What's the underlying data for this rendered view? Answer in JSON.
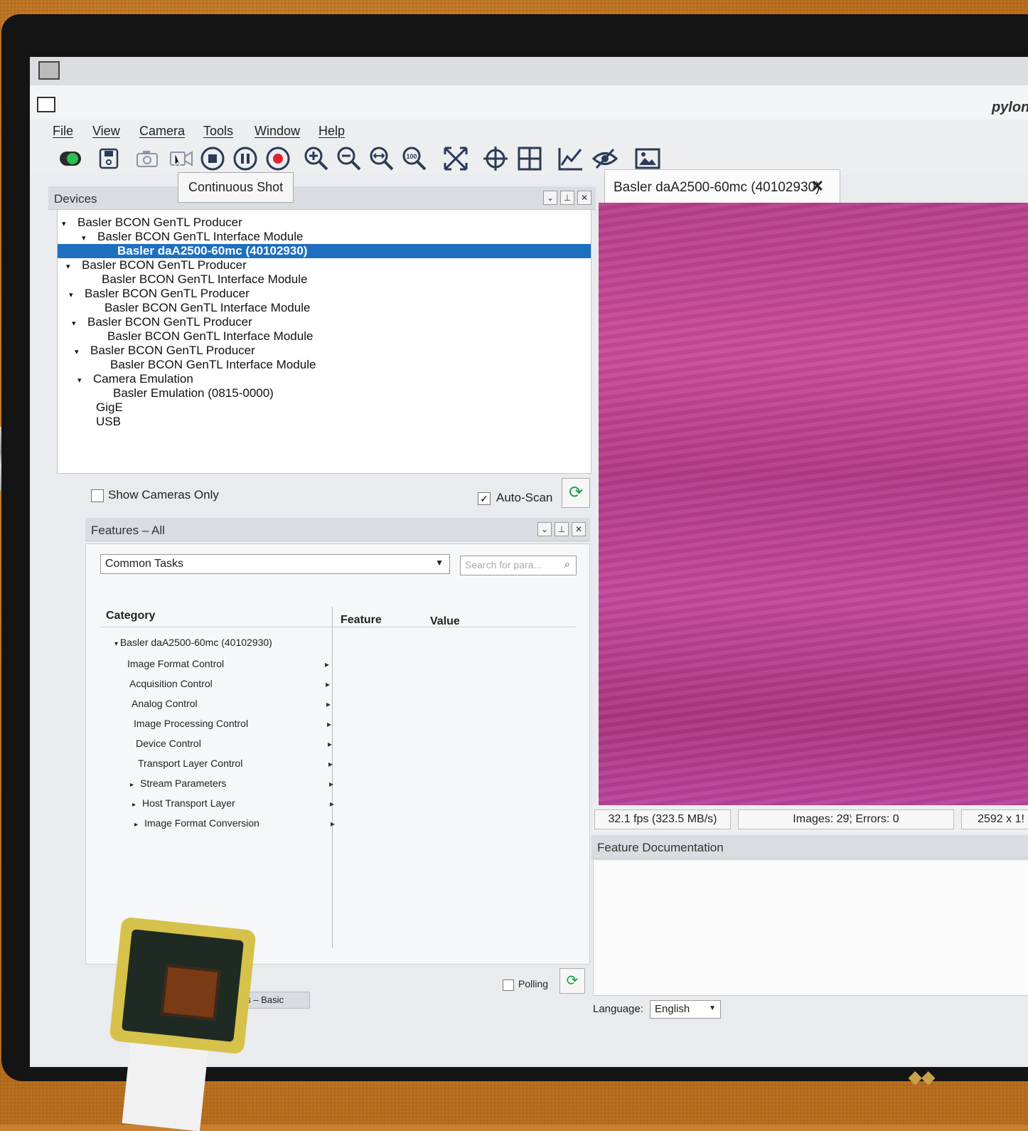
{
  "app": {
    "title": "pylon Vi"
  },
  "menu": [
    "File",
    "View",
    "Camera",
    "Tools",
    "Window",
    "Help"
  ],
  "toolbar": {
    "icons": [
      "device-toggle-icon",
      "save-icon",
      "single-shot-icon",
      "continuous-shot-icon",
      "stop-icon",
      "pause-icon",
      "record-icon",
      "zoom-in-icon",
      "zoom-out-icon",
      "zoom-fit-icon",
      "zoom-100-icon",
      "fullscreen-icon",
      "crosshair-icon",
      "grid-icon",
      "histogram-icon",
      "hide-icon",
      "image-icon"
    ],
    "tooltip": "Continuous Shot",
    "zoom_100_label": "100"
  },
  "devices": {
    "title": "Devices",
    "tree": [
      {
        "label": "Basler BCON GenTL Producer",
        "caret": "▾"
      },
      {
        "label": "Basler BCON GenTL Interface Module",
        "caret": "▾"
      },
      {
        "label": "Basler daA2500-60mc (40102930)",
        "caret": "",
        "selected": true
      },
      {
        "label": "Basler BCON GenTL Producer",
        "caret": "▾"
      },
      {
        "label": "Basler BCON GenTL Interface Module",
        "caret": ""
      },
      {
        "label": "Basler BCON GenTL Producer",
        "caret": "▾"
      },
      {
        "label": "Basler BCON GenTL Interface Module",
        "caret": ""
      },
      {
        "label": "Basler BCON GenTL Producer",
        "caret": "▾"
      },
      {
        "label": "Basler BCON GenTL Interface Module",
        "caret": ""
      },
      {
        "label": "Basler BCON GenTL Producer",
        "caret": "▾"
      },
      {
        "label": "Basler BCON GenTL Interface Module",
        "caret": ""
      },
      {
        "label": "Camera Emulation",
        "caret": "▾"
      },
      {
        "label": "Basler Emulation (0815-0000)",
        "caret": ""
      },
      {
        "label": "GigE",
        "caret": ""
      },
      {
        "label": "USB",
        "caret": ""
      }
    ],
    "show_cameras_only": "Show Cameras Only",
    "auto_scan": "Auto-Scan",
    "auto_scan_checked": "✓"
  },
  "features": {
    "title": "Features – All",
    "preset": "Common Tasks",
    "search_placeholder": "Search for para...",
    "col_category": "Category",
    "col_feature": "Feature",
    "col_value": "Value",
    "root": "Basler daA2500-60mc (40102930)",
    "categories": [
      {
        "label": "Image Format Control",
        "expand": ""
      },
      {
        "label": "Acquisition Control",
        "expand": ""
      },
      {
        "label": "Analog Control",
        "expand": ""
      },
      {
        "label": "Image Processing Control",
        "expand": ""
      },
      {
        "label": "Device Control",
        "expand": ""
      },
      {
        "label": "Transport Layer Control",
        "expand": ""
      },
      {
        "label": "Stream Parameters",
        "expand": "▸"
      },
      {
        "label": "Host Transport Layer",
        "expand": "▸"
      },
      {
        "label": "Image Format Conversion",
        "expand": "▸"
      }
    ],
    "polling": "Polling",
    "bottom_tab": "es – Basic"
  },
  "camera_view": {
    "tab_label": "Basler daA2500-60mc (40102930)",
    "fps": "32.1 fps (323.5 MB/s)",
    "images": "Images: 29̈; Errors: 0",
    "resolution": "2592 x 1!"
  },
  "documentation": {
    "title": "Feature Documentation",
    "language_label": "Language:",
    "language": "English"
  },
  "colors": {
    "selection": "#1f6fc0",
    "refresh": "#1aa04a",
    "image": "#b63f8a"
  }
}
